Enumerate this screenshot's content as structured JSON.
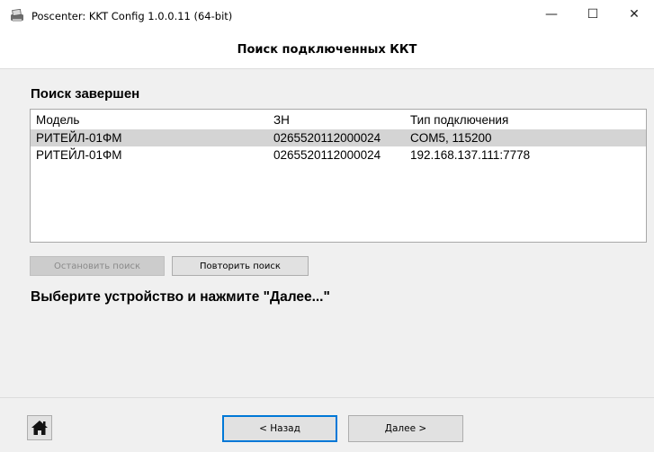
{
  "window": {
    "title": "Poscenter: KKT Config 1.0.0.11 (64-bit)",
    "icon": "printer-icon",
    "minimize": "—",
    "maximize": "☐",
    "close": "✕"
  },
  "header": {
    "title": "Поиск подключенных ККТ"
  },
  "search": {
    "status": "Поиск завершен"
  },
  "table": {
    "columns": [
      "Модель",
      "ЗН",
      "Тип подключения"
    ],
    "rows": [
      {
        "model": "РИТЕЙЛ-01ФМ",
        "sn": "0265520112000024",
        "connection": "COM5, 115200",
        "selected": true
      },
      {
        "model": "РИТЕЙЛ-01ФМ",
        "sn": "0265520112000024",
        "connection": "192.168.137.111:7778",
        "selected": false
      }
    ]
  },
  "buttons": {
    "stop_search": "Остановить поиск",
    "repeat_search": "Повторить поиск",
    "back": "< Назад",
    "next": "Далее >"
  },
  "hint": "Выберите устройство и нажмите \"Далее...\"",
  "colors": {
    "selection": "#d4d4d4",
    "focus": "#0078d7",
    "background": "#f0f0f0"
  }
}
